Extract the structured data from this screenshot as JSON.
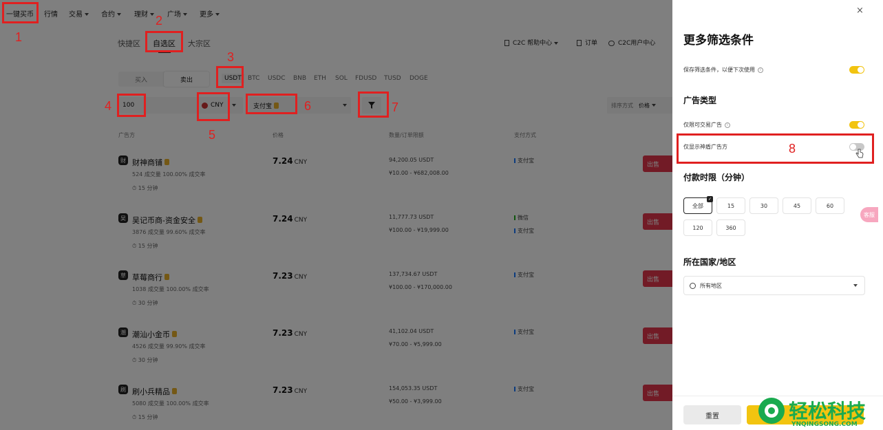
{
  "nav": {
    "items": [
      "一键买币",
      "行情",
      "交易",
      "合约",
      "理财",
      "广场",
      "更多"
    ]
  },
  "zone_tabs": [
    "快捷区",
    "自选区",
    "大宗区"
  ],
  "top_right": {
    "help": "C2C 帮助中心",
    "orders": "订单",
    "user_center": "C2C用户中心"
  },
  "trade_toggle": {
    "buy": "买入",
    "sell": "卖出"
  },
  "coins": [
    "USDT",
    "BTC",
    "USDC",
    "BNB",
    "ETH",
    "SOL",
    "FDUSD",
    "TUSD",
    "DOGE"
  ],
  "filters": {
    "amount": "100",
    "currency": "CNY",
    "payment": "支付宝",
    "sort_label": "排序方式",
    "sort_value": "价格"
  },
  "table": {
    "headers": [
      "广告方",
      "价格",
      "数量/订单限额",
      "支付方式"
    ],
    "rows": [
      {
        "avatar": "财",
        "name": "财神商铺",
        "stats": "524 成交量   100.00% 成交率",
        "time": "15 分钟",
        "price": "7.24",
        "unit": "CNY",
        "qty": "94,200.05 USDT",
        "limit": "¥10.00 - ¥682,008.00",
        "pay": [
          "支付宝"
        ],
        "action": "出售"
      },
      {
        "avatar": "吴",
        "name": "吴记币商-资金安全",
        "stats": "3876 成交量   99.60% 成交率",
        "time": "15 分钟",
        "price": "7.24",
        "unit": "CNY",
        "qty": "11,777.73 USDT",
        "limit": "¥100.00 - ¥19,999.00",
        "pay": [
          "微信",
          "支付宝"
        ],
        "action": "出售"
      },
      {
        "avatar": "草",
        "name": "草莓商行",
        "stats": "1038 成交量   100.00% 成交率",
        "time": "30 分钟",
        "price": "7.23",
        "unit": "CNY",
        "qty": "137,734.67 USDT",
        "limit": "¥100.00 - ¥170,000.00",
        "pay": [
          "支付宝"
        ],
        "action": "出售"
      },
      {
        "avatar": "潮",
        "name": "潮汕小金币",
        "stats": "4526 成交量   99.90% 成交率",
        "time": "30 分钟",
        "price": "7.23",
        "unit": "CNY",
        "qty": "41,102.04 USDT",
        "limit": "¥70.00 - ¥5,999.00",
        "pay": [
          "支付宝"
        ],
        "action": "出售"
      },
      {
        "avatar": "刷",
        "name": "刷小兵精品",
        "stats": "5080 成交量   100.00% 成交率",
        "time": "15 分钟",
        "price": "7.23",
        "unit": "CNY",
        "qty": "154,053.35 USDT",
        "limit": "¥50.00 - ¥3,999.00",
        "pay": [
          "支付宝"
        ],
        "action": "出售"
      }
    ]
  },
  "panel": {
    "title": "更多筛选条件",
    "save_label": "保存筛选条件，以便下次使用",
    "ad_type_title": "广告类型",
    "tradable_label": "仅限可交易广告",
    "verified_label": "仅显示神盾广告方",
    "payment_time_title": "付款时限（分钟）",
    "time_options": [
      "全部",
      "15",
      "30",
      "45",
      "60",
      "120",
      "360"
    ],
    "region_title": "所在国家/地区",
    "region_value": "所有地区",
    "reset": "重置"
  },
  "float_button": "客服",
  "annotations": [
    "1",
    "2",
    "3",
    "4",
    "5",
    "6",
    "7",
    "8"
  ],
  "watermark": {
    "brand": "轻松科技",
    "url": "YNQINGSONG.COM"
  },
  "colors": {
    "accent_yellow": "#f2c410",
    "sell_red": "#e5374c",
    "annotation_red": "#e02020"
  }
}
